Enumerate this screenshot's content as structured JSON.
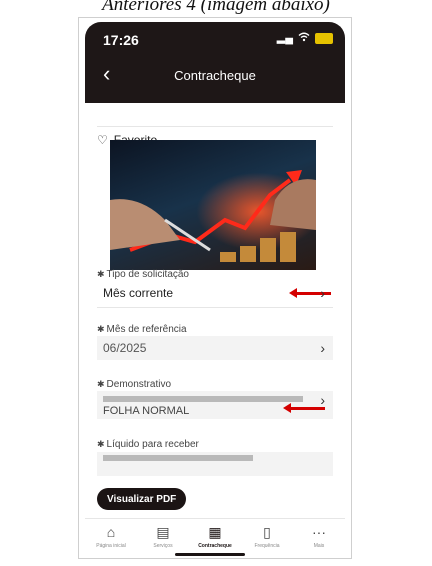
{
  "caption": "Anteriores 4 (imagem abaixo)",
  "status_bar": {
    "time": "17:26"
  },
  "header": {
    "back_icon": "chevron-left-icon",
    "title": "Contracheque"
  },
  "favorite": {
    "icon": "heart-outline-icon",
    "label": "Favorito"
  },
  "fields": [
    {
      "label": "Tipo de solicitação",
      "value": "Mês corrente"
    },
    {
      "label": "Mês de referência",
      "value": "06/2025"
    },
    {
      "label": "Demonstrativo",
      "value": "FOLHA NORMAL"
    },
    {
      "label": "Líquido para receber",
      "value": ""
    }
  ],
  "button": {
    "label": "Visualizar PDF"
  },
  "tabbar": [
    {
      "label": "Página inicial",
      "icon": "home-icon"
    },
    {
      "label": "Serviços",
      "icon": "services-icon"
    },
    {
      "label": "Contracheque",
      "icon": "payslip-icon",
      "active": true
    },
    {
      "label": "Frequência",
      "icon": "document-icon"
    },
    {
      "label": "Mais",
      "icon": "more-icon"
    }
  ],
  "colors": {
    "header_bg": "#1e1717",
    "accent": "#d40000",
    "button_bg": "#1b1414"
  }
}
